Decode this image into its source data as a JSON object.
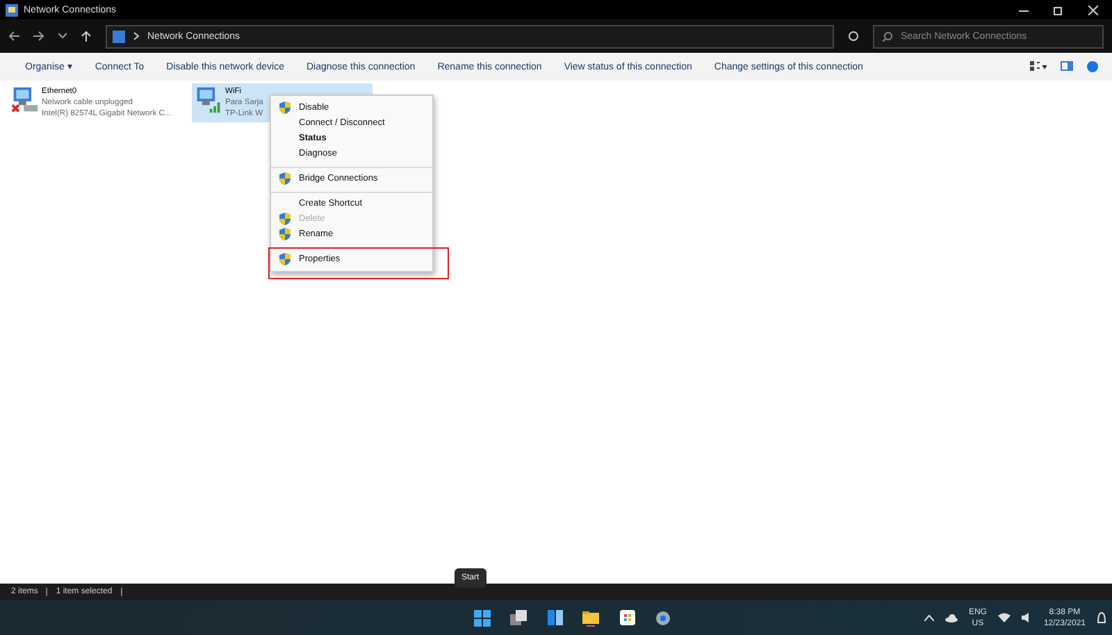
{
  "window": {
    "title": "Network Connections"
  },
  "address": {
    "path": "Network Connections",
    "search_placeholder": "Search Network Connections"
  },
  "toolbar": [
    "Organise ▾",
    "Connect To",
    "Disable this network device",
    "Diagnose this connection",
    "Rename this connection",
    "View status of this connection",
    "Change settings of this connection"
  ],
  "items": [
    {
      "kind": "ethernet",
      "name": "Ethernet0",
      "status": "Network cable unplugged",
      "device": "Intel(R) 82574L Gigabit Network C...",
      "selected": false
    },
    {
      "kind": "wifi",
      "name": "WiFi",
      "status": "Para Sarja",
      "device": "TP-Link W",
      "selected": true
    }
  ],
  "context_menu": [
    {
      "label": "Disable",
      "shield": true,
      "bold": false,
      "disabled": false,
      "divider_after": false,
      "highlighted": false
    },
    {
      "label": "Connect / Disconnect",
      "shield": false,
      "bold": false,
      "disabled": false,
      "divider_after": false,
      "highlighted": false
    },
    {
      "label": "Status",
      "shield": false,
      "bold": true,
      "disabled": false,
      "divider_after": false,
      "highlighted": false
    },
    {
      "label": "Diagnose",
      "shield": false,
      "bold": false,
      "disabled": false,
      "divider_after": true,
      "highlighted": false
    },
    {
      "label": "Bridge Connections",
      "shield": true,
      "bold": false,
      "disabled": false,
      "divider_after": true,
      "highlighted": false
    },
    {
      "label": "Create Shortcut",
      "shield": false,
      "bold": false,
      "disabled": false,
      "divider_after": false,
      "highlighted": false
    },
    {
      "label": "Delete",
      "shield": true,
      "bold": false,
      "disabled": true,
      "divider_after": false,
      "highlighted": false
    },
    {
      "label": "Rename",
      "shield": true,
      "bold": false,
      "disabled": false,
      "divider_after": true,
      "highlighted": false
    },
    {
      "label": "Properties",
      "shield": true,
      "bold": false,
      "disabled": false,
      "divider_after": false,
      "highlighted": true
    }
  ],
  "status_bar": [
    "2 items",
    "1 item selected"
  ],
  "tooltip": "Start",
  "tray": {
    "lang": "ENG",
    "region": "US",
    "time": "8:38 PM",
    "date": "12/23/2021"
  }
}
